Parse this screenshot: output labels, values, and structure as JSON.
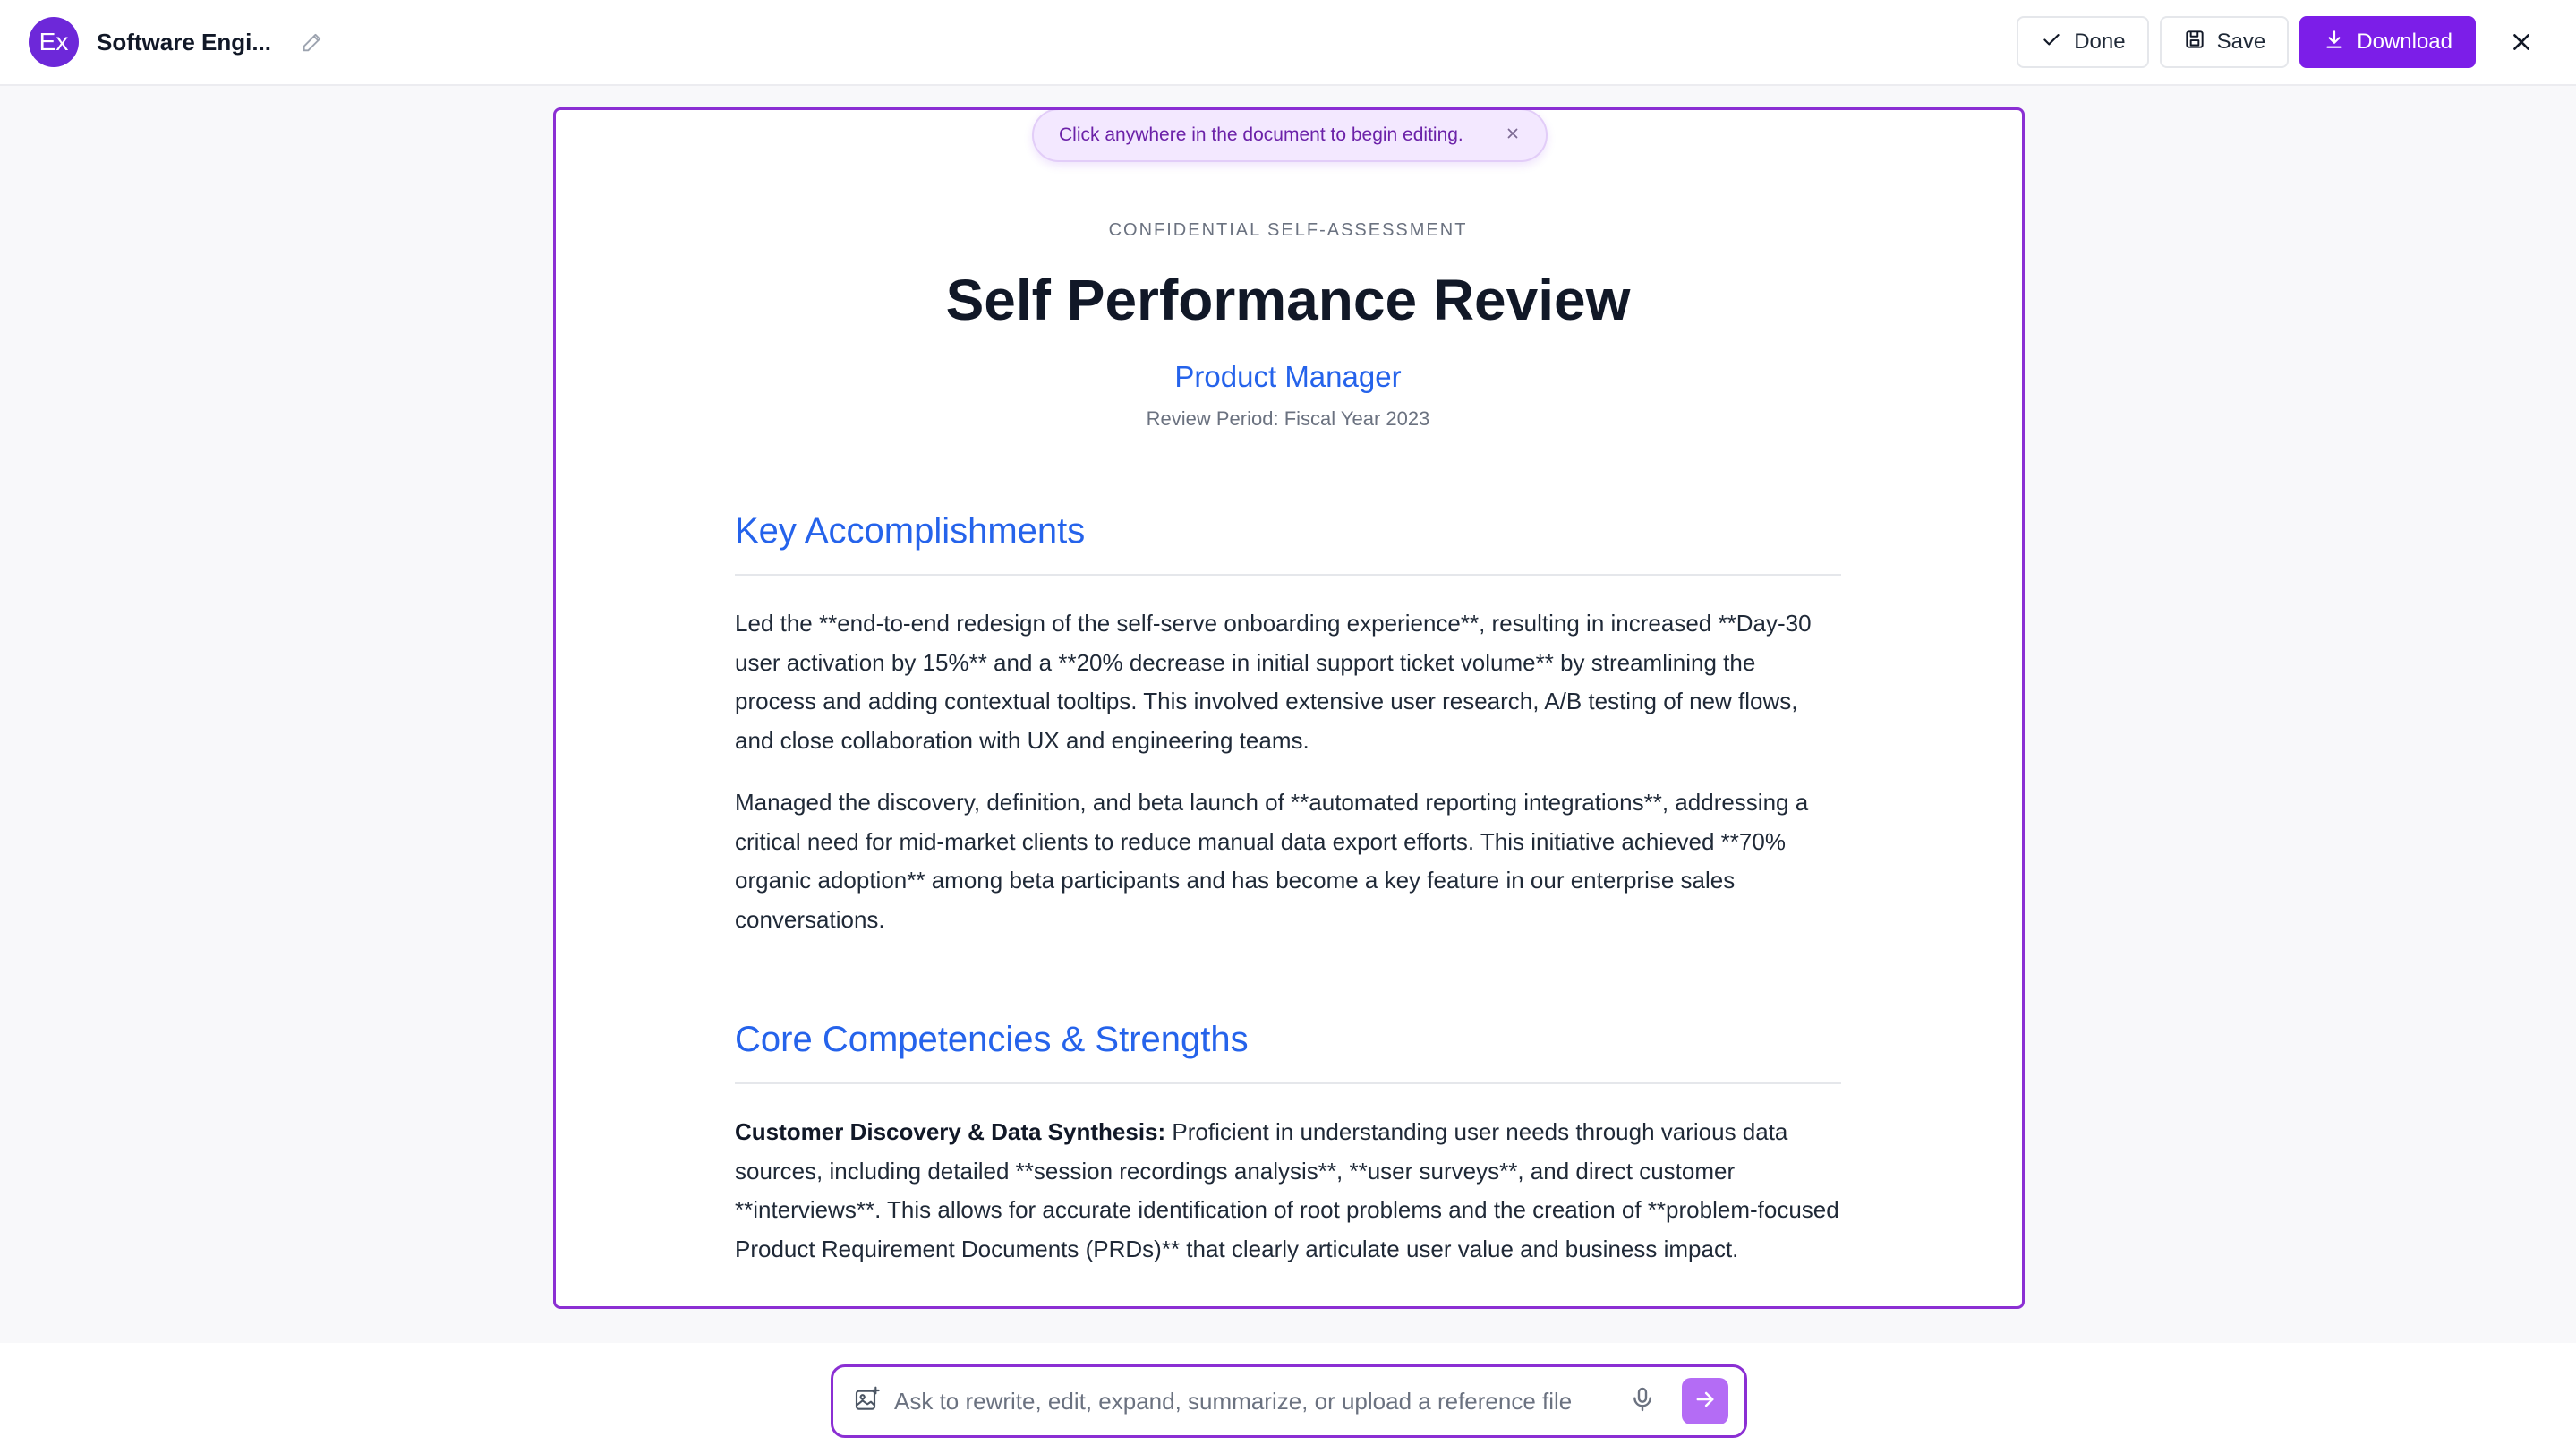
{
  "header": {
    "avatar_text": "Ex",
    "doc_name": "Software Engi...",
    "done_label": "Done",
    "save_label": "Save",
    "download_label": "Download"
  },
  "hint": {
    "text": "Click anywhere in the document to begin editing."
  },
  "document": {
    "eyebrow": "CONFIDENTIAL SELF-ASSESSMENT",
    "title": "Self Performance Review",
    "role": "Product Manager",
    "period": "Review Period: Fiscal Year 2023",
    "sections": [
      {
        "title": "Key Accomplishments",
        "paragraphs": [
          "Led the **end-to-end redesign of the self-serve onboarding experience**, resulting in increased **Day-30 user activation by 15%** and a **20% decrease in initial support ticket volume** by streamlining the process and adding contextual tooltips. This involved extensive user research, A/B testing of new flows, and close collaboration with UX and engineering teams.",
          "Managed the discovery, definition, and beta launch of **automated reporting integrations**, addressing a critical need for mid-market clients to reduce manual data export efforts. This initiative achieved **70% organic adoption** among beta participants and has become a key feature in our enterprise sales conversations."
        ]
      },
      {
        "title": "Core Competencies & Strengths",
        "paragraphs": [
          {
            "lead": "Customer Discovery & Data Synthesis:",
            "text": " Proficient in understanding user needs through various data sources, including detailed **session recordings analysis**, **user surveys**, and direct customer **interviews**. This allows for accurate identification of root problems and the creation of **problem-focused Product Requirement Documents (PRDs)** that clearly articulate user value and business impact."
          }
        ]
      }
    ]
  },
  "prompt": {
    "placeholder": "Ask to rewrite, edit, expand, summarize, or upload a reference file"
  },
  "colors": {
    "accent": "#7c1ee8",
    "border_accent": "#8b2fd3",
    "link_blue": "#2563eb"
  },
  "icons": [
    "pencil-icon",
    "check-icon",
    "save-icon",
    "download-icon",
    "close-icon",
    "image-icon",
    "mic-icon",
    "arrow-right-icon"
  ]
}
